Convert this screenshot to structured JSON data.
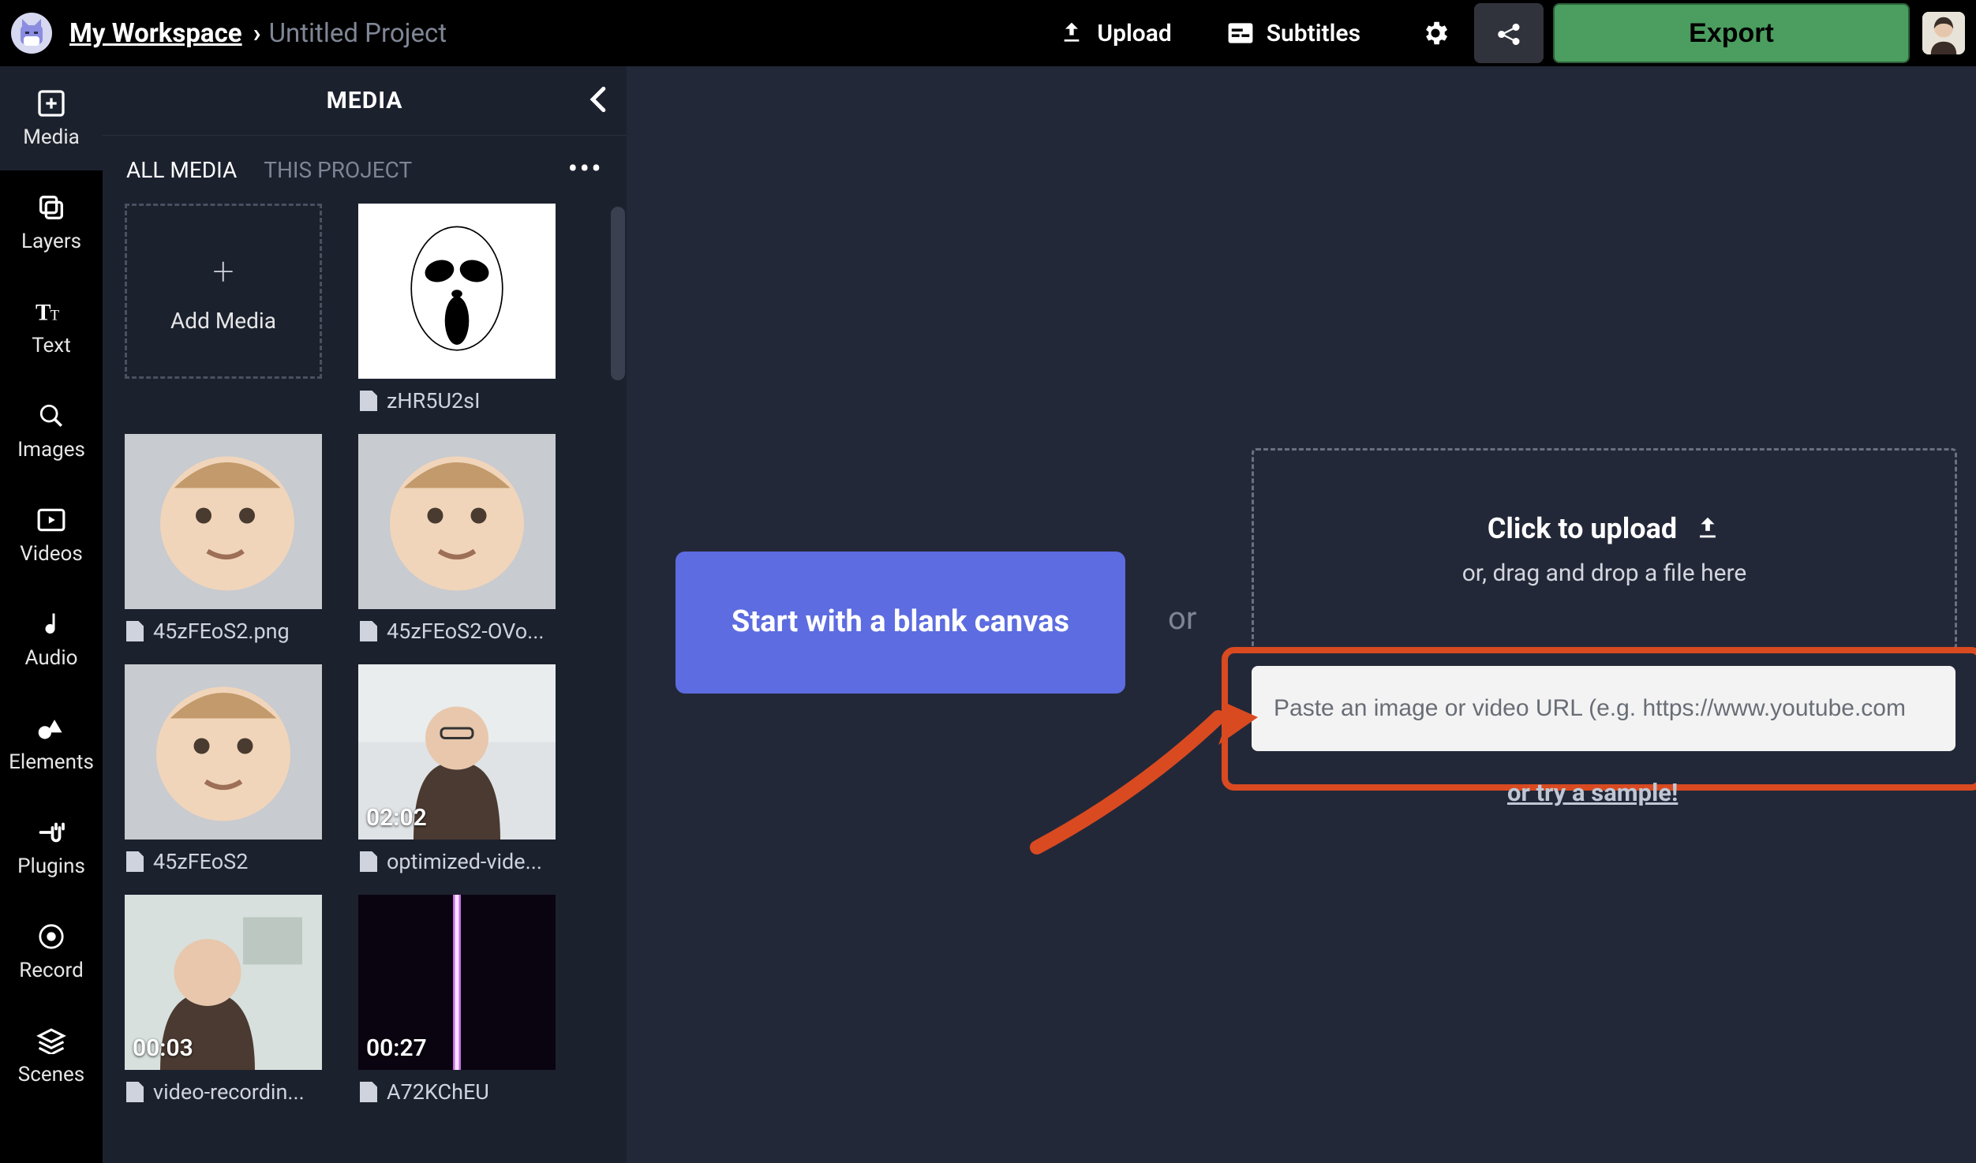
{
  "topbar": {
    "workspace": "My Workspace",
    "project": "Untitled Project",
    "upload": "Upload",
    "subtitles": "Subtitles",
    "export": "Export"
  },
  "rail": {
    "media": "Media",
    "layers": "Layers",
    "text": "Text",
    "images": "Images",
    "videos": "Videos",
    "audio": "Audio",
    "elements": "Elements",
    "plugins": "Plugins",
    "record": "Record",
    "scenes": "Scenes"
  },
  "mediaPanel": {
    "title": "MEDIA",
    "tabs": {
      "all": "ALL MEDIA",
      "project": "THIS PROJECT"
    },
    "addMedia": "Add Media",
    "items": [
      {
        "name": "zHR5U2sI"
      },
      {
        "name": "45zFEoS2.png"
      },
      {
        "name": "45zFEoS2-OVo..."
      },
      {
        "name": "45zFEoS2"
      },
      {
        "name": "optimized-vide...",
        "duration": "02:02"
      },
      {
        "name": "video-recordin...",
        "duration": "00:03"
      },
      {
        "name": "A72KChEU",
        "duration": "00:27"
      }
    ]
  },
  "main": {
    "start_button": "Start with a blank canvas",
    "or": "or",
    "upload_title": "Click to upload",
    "upload_sub": "or, drag and drop a file here",
    "url_placeholder": "Paste an image or video URL (e.g. https://www.youtube.com",
    "sample_link": "or try a sample!"
  }
}
